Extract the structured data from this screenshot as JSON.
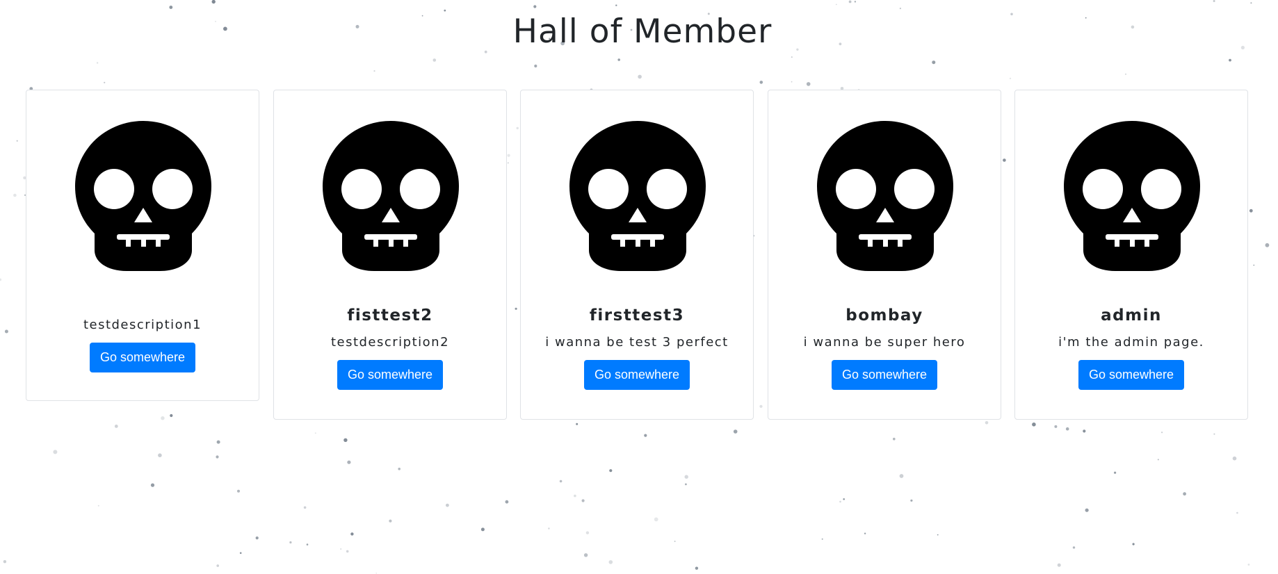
{
  "page": {
    "title": "Hall of Member"
  },
  "colors": {
    "button": "#007bff",
    "card_border": "#dfe2e6",
    "text": "#212529",
    "particle": "#556270"
  },
  "members": [
    {
      "name": "",
      "description": "testdescription1",
      "button_label": "Go somewhere",
      "avatar_icon": "skull-icon"
    },
    {
      "name": "fisttest2",
      "description": "testdescription2",
      "button_label": "Go somewhere",
      "avatar_icon": "skull-icon"
    },
    {
      "name": "firsttest3",
      "description": "i wanna be test 3 perfect",
      "button_label": "Go somewhere",
      "avatar_icon": "skull-icon"
    },
    {
      "name": "bombay",
      "description": "i wanna be super hero",
      "button_label": "Go somewhere",
      "avatar_icon": "skull-icon"
    },
    {
      "name": "admin",
      "description": "i'm the admin page.",
      "button_label": "Go somewhere",
      "avatar_icon": "skull-icon"
    }
  ]
}
